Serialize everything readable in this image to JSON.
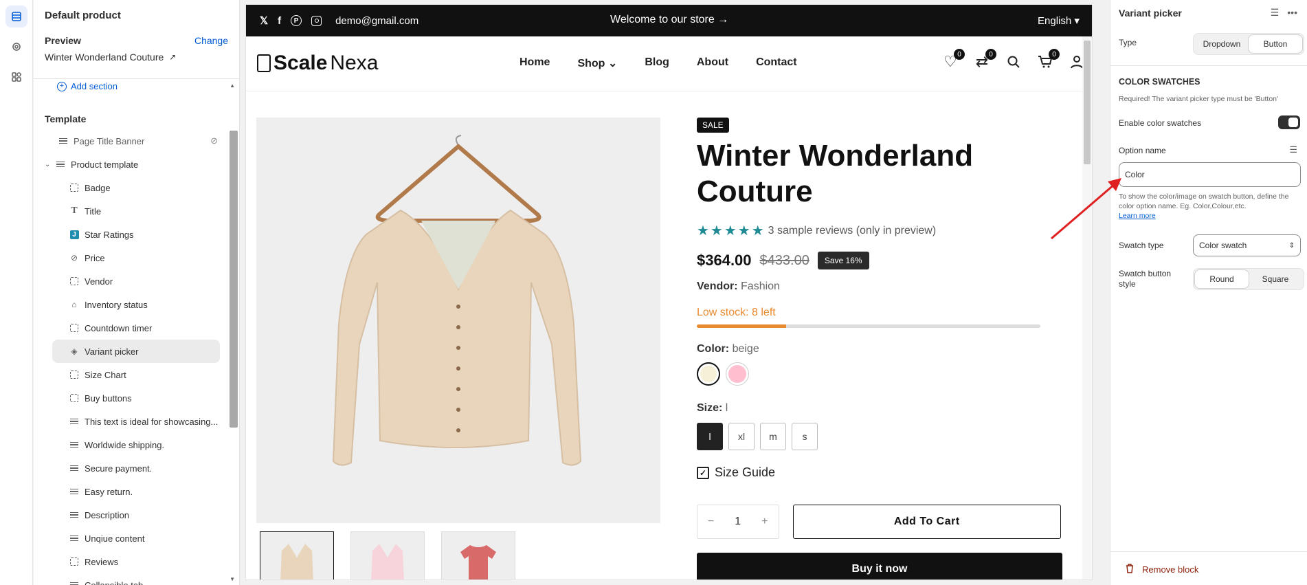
{
  "rail": {
    "icons": [
      "sections-icon",
      "settings-icon",
      "apps-icon"
    ]
  },
  "sidebar": {
    "title": "Default product",
    "preview_label": "Preview",
    "change_label": "Change",
    "product": "Winter Wonderland Couture",
    "add_section": "Add section",
    "template_label": "Template",
    "page_title_banner": "Page Title Banner",
    "product_template": "Product template",
    "items": [
      {
        "label": "Badge",
        "icon": "block-icon"
      },
      {
        "label": "Title",
        "icon": "text-icon"
      },
      {
        "label": "Star Ratings",
        "icon": "app-j-icon"
      },
      {
        "label": "Price",
        "icon": "price-tag-icon"
      },
      {
        "label": "Vendor",
        "icon": "block-icon"
      },
      {
        "label": "Inventory status",
        "icon": "inventory-icon"
      },
      {
        "label": "Countdown timer",
        "icon": "block-icon"
      },
      {
        "label": "Variant picker",
        "icon": "variant-icon"
      },
      {
        "label": "Size Chart",
        "icon": "block-icon"
      },
      {
        "label": "Buy buttons",
        "icon": "block-icon"
      },
      {
        "label": "This text is ideal for showcasing...",
        "icon": "lines-icon"
      },
      {
        "label": "Worldwide shipping.",
        "icon": "lines-icon"
      },
      {
        "label": "Secure payment.",
        "icon": "lines-icon"
      },
      {
        "label": "Easy return.",
        "icon": "lines-icon"
      },
      {
        "label": "Description",
        "icon": "lines-icon"
      },
      {
        "label": "Unqiue content",
        "icon": "lines-icon"
      },
      {
        "label": "Reviews",
        "icon": "block-icon"
      },
      {
        "label": "Collapsible tab",
        "icon": "lines-icon"
      }
    ]
  },
  "store": {
    "email": "demo@gmail.com",
    "welcome": "Welcome to our store →",
    "language": "English ▾",
    "logo_bold": "Scale",
    "logo_light": "Nexa",
    "nav": [
      "Home",
      "Shop",
      "Blog",
      "About",
      "Contact"
    ],
    "shop_caret": "⌄",
    "wishlist_count": "0",
    "compare_count": "0",
    "cart_count": "0"
  },
  "product": {
    "badge": "SALE",
    "title": "Winter Wonderland Couture",
    "stars": "★★★★★",
    "reviews": "3 sample reviews (only in preview)",
    "price": "$364.00",
    "compare_price": "$433.00",
    "save": "Save 16%",
    "vendor_label": "Vendor:",
    "vendor": "Fashion",
    "stock": "Low stock: 8 left",
    "stock_fraction": 0.26,
    "color_label": "Color:",
    "color_value": "beige",
    "swatches": [
      {
        "name": "beige",
        "hex": "#f5f0d6"
      },
      {
        "name": "pink",
        "hex": "#ffbfcf"
      }
    ],
    "size_label": "Size:",
    "size_value": "l",
    "sizes": [
      "l",
      "xl",
      "m",
      "s"
    ],
    "size_guide": "Size Guide",
    "qty": "1",
    "qty_minus": "−",
    "qty_plus": "+",
    "add_to_cart": "Add To Cart",
    "buy_now": "Buy it now"
  },
  "panel": {
    "title": "Variant picker",
    "type_label": "Type",
    "type_options": [
      "Dropdown",
      "Button"
    ],
    "type_selected": "Button",
    "section_heading": "COLOR SWATCHES",
    "required_note": "Required! The variant picker type must be 'Button'",
    "enable_label": "Enable color swatches",
    "enable_on": true,
    "option_name_label": "Option name",
    "option_name_value": "Color",
    "help_text": "To show the color/image on swatch button, define the color option name. Eg. Color,Colour,etc.",
    "learn_more": "Learn more",
    "swatch_type_label": "Swatch type",
    "swatch_type_value": "Color swatch",
    "button_style_label": "Swatch button style",
    "button_style_options": [
      "Round",
      "Square"
    ],
    "button_style_selected": "Round",
    "remove_block": "Remove block"
  },
  "colors": {
    "accent": "#005bd3",
    "annotation_arrow": "#e02020",
    "stock": "#e88a2e",
    "star": "#1e8a94"
  }
}
